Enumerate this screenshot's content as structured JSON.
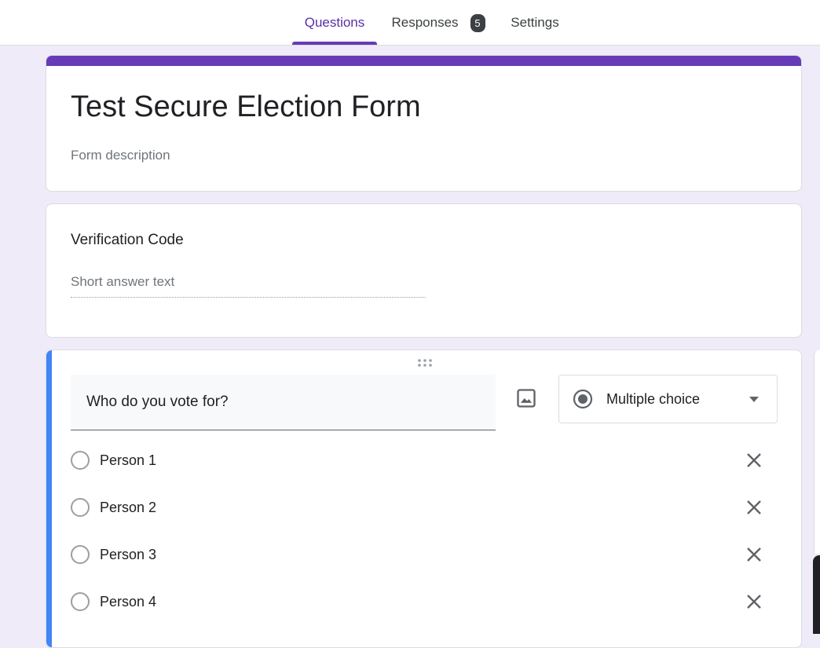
{
  "tabs": {
    "questions": "Questions",
    "responses": "Responses",
    "responses_count": "5",
    "settings": "Settings"
  },
  "form": {
    "title": "Test Secure Election Form",
    "description_placeholder": "Form description"
  },
  "question1": {
    "title": "Verification Code",
    "answer_placeholder": "Short answer text"
  },
  "question2": {
    "title": "Who do you vote for?",
    "type": "Multiple choice",
    "options": [
      "Person 1",
      "Person 2",
      "Person 3",
      "Person 4"
    ]
  },
  "colors": {
    "accent": "#673ab7",
    "active_bar": "#4285f4",
    "background": "#f0ebf8"
  }
}
